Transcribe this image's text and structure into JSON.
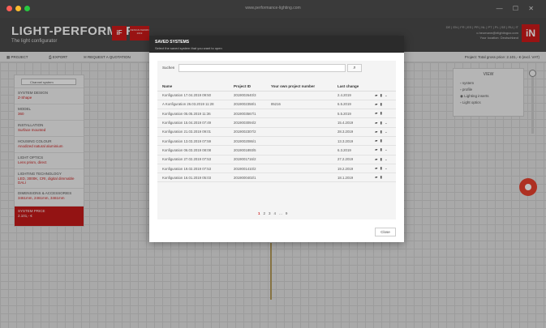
{
  "window": {
    "url": "www.performance-lighting.com",
    "controls": "— ☐ ✕"
  },
  "header": {
    "logo": "LIGHT-PERFORMER",
    "tagline": "The light configurator",
    "if_badge": "iF",
    "award_badge": "DESIGN AWARD 2019",
    "languages": "DE | EN | FR | ES | PR | NL | PT | PL | SE | RU | IT",
    "user_name": "c.heumann@elightingco.com",
    "user_location": "Your location: Deutschland",
    "brand": "iN"
  },
  "toolbar": {
    "project": "PROJECT",
    "export": "EXPORT",
    "quotation": "REQUEST A QUOTATION",
    "project_info": "Project: Total gross price: 2.101,- € (excl. VAT)"
  },
  "left_panel": {
    "select_label": "Channel system",
    "items": [
      {
        "name": "System design",
        "value": "Z-Shape"
      },
      {
        "name": "Model",
        "value": "360"
      },
      {
        "name": "Installation",
        "value": "Surface mounted"
      },
      {
        "name": "Housing colour",
        "value": "Anodized natural aluminium"
      },
      {
        "name": "Light optics",
        "value": "Lens prism, direct"
      },
      {
        "name": "Lighting technology",
        "value": "LED, 3000K, CRI, digital dimmable DALI"
      },
      {
        "name": "Dimensions & accessories",
        "value": "3461mm, 2461mm, 3461mm"
      }
    ],
    "price": {
      "name": "System price",
      "value": "2.101,- €"
    }
  },
  "right_panel": {
    "title": "VIEW",
    "items": [
      "system",
      "profile",
      "Lighting inserts",
      "Light optics"
    ]
  },
  "modal": {
    "title": "SAVED SYSTEMS",
    "subtitle": "Select the saved system that you want to open",
    "search_label": "Suchen",
    "search_value": "",
    "search_icon": "⌕",
    "columns": [
      "Name",
      "Project ID",
      "Your own project number",
      "Last change",
      ""
    ],
    "rows": [
      {
        "name": "Konfiguration 17.04.2019 09:50",
        "id": "2019002640/3",
        "own": "",
        "date": "2.4.2019",
        "actions": "▰ ▮ ⌄"
      },
      {
        "name": "A Konfiguration 26.03.2019 11:28",
        "id": "2019002358/1",
        "own": "85216",
        "date": "6.5.2019",
        "actions": "▰ ▮"
      },
      {
        "name": "Konfiguration 05.05.2019 11:36",
        "id": "2019003567/1",
        "own": "",
        "date": "5.5.2019",
        "actions": "▰ ▮"
      },
      {
        "name": "Konfiguration 15.04.2019 07:49",
        "id": "2019003094/2",
        "own": "",
        "date": "15.4.2019",
        "actions": "▰ ▮ ⌄"
      },
      {
        "name": "Konfiguration 21.03.2019 09:01",
        "id": "2019002307/2",
        "own": "",
        "date": "28.3.2019",
        "actions": "▰ ▮ ⌄"
      },
      {
        "name": "Konfiguration 13.03.2019 07:59",
        "id": "2019002086/1",
        "own": "",
        "date": "13.3.2019",
        "actions": "▰ ▮"
      },
      {
        "name": "Konfiguration 06.03.2019 08:08",
        "id": "2019001893/5",
        "own": "",
        "date": "6.3.2019",
        "actions": "▰ ▮ ⌄"
      },
      {
        "name": "Konfiguration 27.02.2019 07:53",
        "id": "2019001716/2",
        "own": "",
        "date": "27.2.2019",
        "actions": "▰ ▮ ⌄"
      },
      {
        "name": "Konfiguration 19.02.2019 07:53",
        "id": "2019001410/2",
        "own": "",
        "date": "19.2.2019",
        "actions": "▰ ▮ ⌄"
      },
      {
        "name": "Konfiguration 16.01.2019 05:03",
        "id": "2019000402/1",
        "own": "",
        "date": "18.1.2019",
        "actions": "▰ ▮"
      }
    ],
    "pages": [
      "1",
      "2",
      "3",
      "4",
      "...",
      "9"
    ],
    "close": "Close"
  },
  "colors": {
    "accent": "#c41a1a",
    "dark": "#2b2b2b",
    "chat": "#e8402e"
  }
}
